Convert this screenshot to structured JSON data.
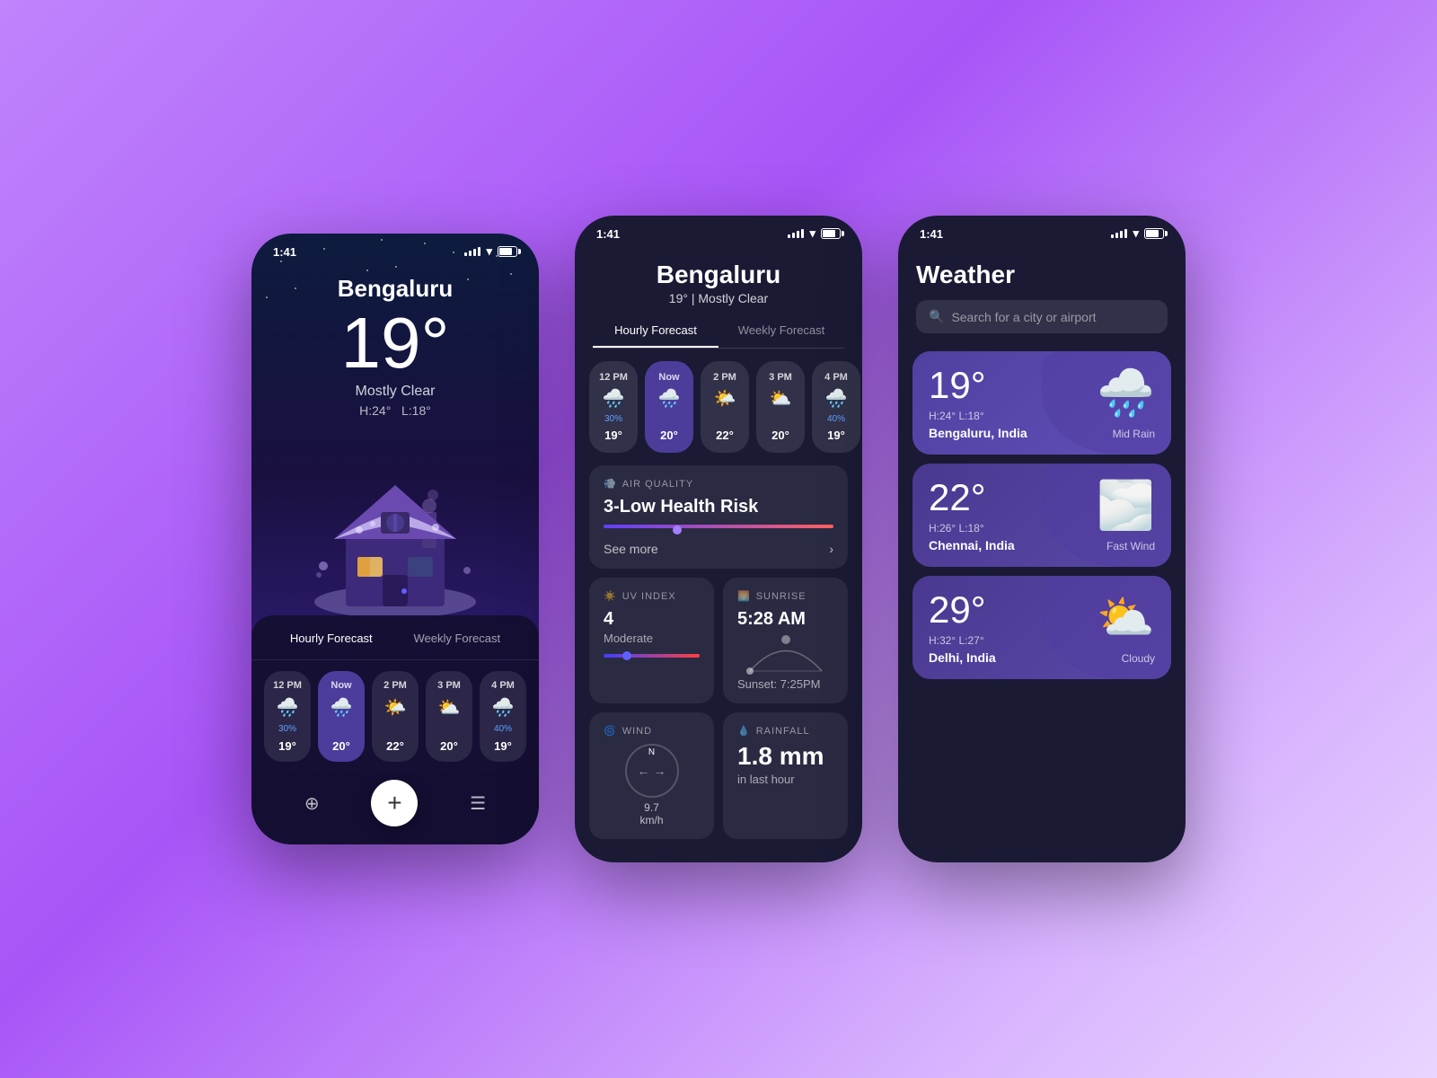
{
  "background": {
    "gradient_start": "#c084fc",
    "gradient_end": "#e9d5ff"
  },
  "phone1": {
    "status_time": "1:41",
    "city": "Bengaluru",
    "temperature": "19°",
    "description": "Mostly Clear",
    "high": "H:24°",
    "low": "L:18°",
    "tabs": {
      "hourly": "Hourly Forecast",
      "weekly": "Weekly Forecast"
    },
    "hourly": [
      {
        "time": "12 PM",
        "icon": "🌧️",
        "rain": "30%",
        "temp": "19°",
        "active": false
      },
      {
        "time": "Now",
        "icon": "🌧️",
        "rain": "",
        "temp": "20°",
        "active": true
      },
      {
        "time": "2 PM",
        "icon": "🌤️",
        "rain": "",
        "temp": "22°",
        "active": false
      },
      {
        "time": "3 PM",
        "icon": "⛅",
        "rain": "",
        "temp": "20°",
        "active": false
      },
      {
        "time": "4 PM",
        "icon": "🌧️",
        "rain": "40%",
        "temp": "19°",
        "active": false
      }
    ],
    "nav": {
      "location": "⊕",
      "add": "+",
      "menu": "☰"
    }
  },
  "phone2": {
    "status_time": "1:41",
    "city": "Bengaluru",
    "subtitle": "19° | Mostly Clear",
    "tabs": [
      "Hourly Forecast",
      "Weekly Forecast"
    ],
    "active_tab": 0,
    "hourly": [
      {
        "time": "12 PM",
        "icon": "🌧️",
        "rain": "30%",
        "temp": "19°",
        "active": false
      },
      {
        "time": "Now",
        "icon": "🌧️",
        "rain": "",
        "temp": "20°",
        "active": true
      },
      {
        "time": "2 PM",
        "icon": "🌤️",
        "rain": "",
        "temp": "22°",
        "active": false
      },
      {
        "time": "3 PM",
        "icon": "⛅",
        "rain": "",
        "temp": "20°",
        "active": false
      },
      {
        "time": "4 PM",
        "icon": "🌧️",
        "rain": "40%",
        "temp": "19°",
        "active": false
      }
    ],
    "air_quality": {
      "label": "AIR QUALITY",
      "value": "3-Low Health Risk",
      "see_more": "See more"
    },
    "uv_index": {
      "label": "UV INDEX",
      "value": "4",
      "sub": "Moderate"
    },
    "sunrise": {
      "label": "SUNRISE",
      "value": "5:28 AM",
      "sunset": "Sunset: 7:25PM"
    },
    "wind": {
      "label": "WIND",
      "direction": "N",
      "speed": "9.7",
      "unit": "km/h"
    },
    "rainfall": {
      "label": "RAINFALL",
      "value": "1.8 mm",
      "sub": "in last hour"
    }
  },
  "phone3": {
    "status_time": "1:41",
    "title": "Weather",
    "search_placeholder": "Search for a city or airport",
    "cities": [
      {
        "temp": "19°",
        "high_low": "H:24°  L:18°",
        "name": "Bengaluru, India",
        "condition": "Mid Rain",
        "icon": "🌧️",
        "bg": "#5040a0"
      },
      {
        "temp": "22°",
        "high_low": "H:26°  L:18°",
        "name": "Chennai, India",
        "condition": "Fast Wind",
        "icon": "🌫️",
        "bg": "#4a3890"
      },
      {
        "temp": "29°",
        "high_low": "H:32°  L:27°",
        "name": "Delhi, India",
        "condition": "Cloudy",
        "icon": "⛅",
        "bg": "#4a3890"
      }
    ]
  }
}
